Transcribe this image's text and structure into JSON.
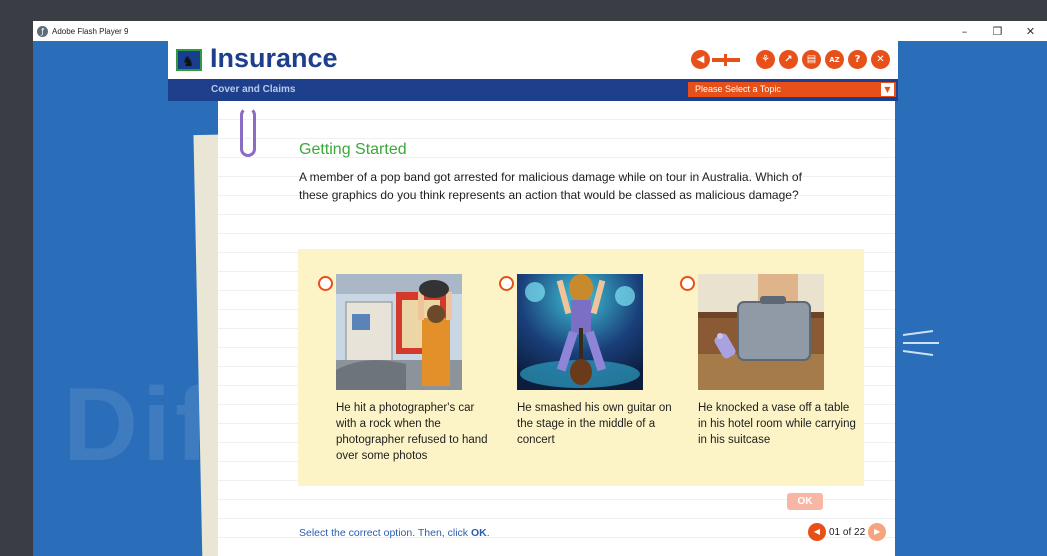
{
  "window": {
    "title": "Adobe Flash Player 9",
    "controls": {
      "minimize": "–",
      "maximize": "❐",
      "close": "✕"
    }
  },
  "watermark": "Diffe                  ns",
  "app": {
    "title": "Insurance",
    "section": "Cover and Claims",
    "topic_placeholder": "Please Select a Topic",
    "toolbar": [
      {
        "name": "sitemap",
        "glyph": "⚘"
      },
      {
        "name": "glossary",
        "glyph": "↗"
      },
      {
        "name": "notes",
        "glyph": "▤"
      },
      {
        "name": "a-z",
        "glyph": "AZ"
      },
      {
        "name": "help",
        "glyph": "?"
      },
      {
        "name": "exit",
        "glyph": "✕"
      }
    ]
  },
  "lesson": {
    "heading": "Getting Started",
    "question": "A member of a pop band got arrested for malicious damage while on tour in Australia. Which of these graphics do you think represents an action that would be classed as malicious damage?",
    "options": [
      {
        "caption": "He hit a photographer's car with a rock when the photographer refused to hand over some photos"
      },
      {
        "caption": "He smashed his own guitar on the stage in the middle of a concert"
      },
      {
        "caption": "He knocked a vase off a table in his hotel room while carrying in his suitcase"
      }
    ],
    "ok_label": "OK",
    "instruction_prefix": "Select the correct option. Then, click ",
    "instruction_ok": "OK",
    "instruction_suffix": ".",
    "page_counter": "01 of 22"
  },
  "colors": {
    "accent": "#e8501a",
    "brand_blue": "#1d3f8c",
    "heading_green": "#3aa83a",
    "option_panel": "#fcf3c7"
  }
}
